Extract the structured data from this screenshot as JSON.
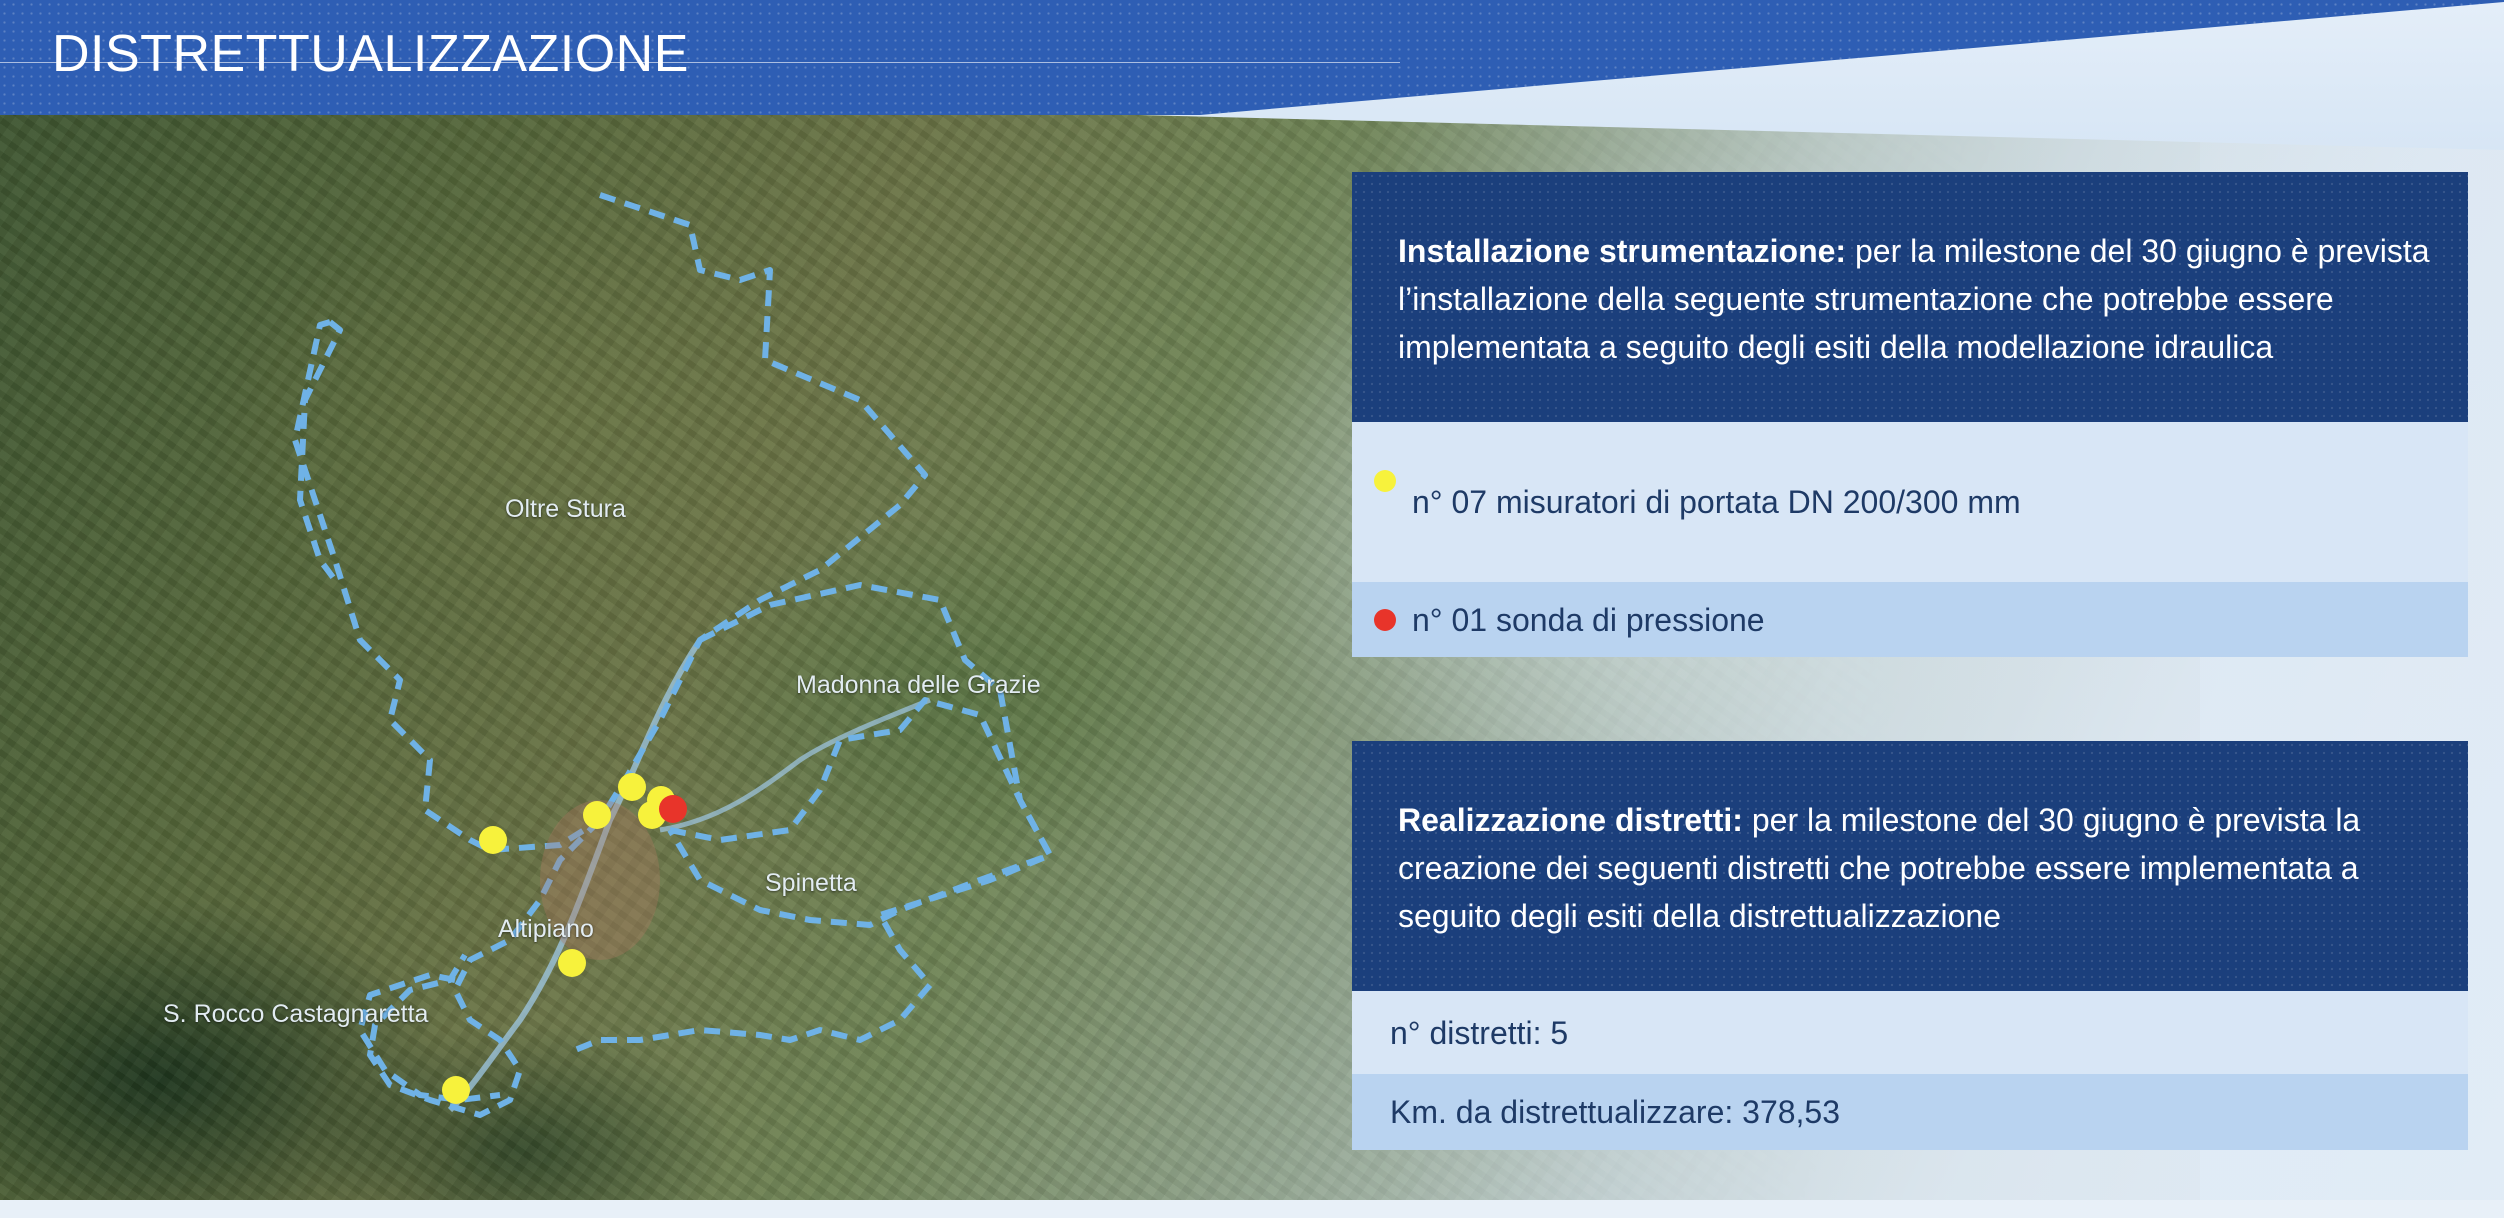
{
  "header": {
    "title": "DISTRETTUALIZZAZIONE",
    "color": "#2e5eb4"
  },
  "map": {
    "place_labels": {
      "oltre_stura": "Oltre Stura",
      "madonna_delle_grazie": "Madonna delle Grazie",
      "spinetta": "Spinetta",
      "altipiano": "Altipiano",
      "s_rocco": "S. Rocco Castagnaretta"
    },
    "district_boundary_color": "#6fb2e6",
    "marker_colors": {
      "flow_meter": "#f7f23c",
      "pressure_probe": "#e8342a"
    },
    "flow_meter_count_shown": 7,
    "pressure_probe_count_shown": 1
  },
  "instrumentation": {
    "heading": "Installazione strumentazione:",
    "text": " per la milestone del 30 giugno è prevista l’installazione della seguente strumentazione che potrebbe essere implementata a seguito degli esiti della modellazione idraulica",
    "items": [
      {
        "label": "n° 07 misuratori di portata DN 200/300 mm",
        "icon": "yellow-dot-icon"
      },
      {
        "label": "n° 01 sonda di pressione",
        "icon": "red-dot-icon"
      }
    ]
  },
  "districts": {
    "heading": "Realizzazione distretti:",
    "text": " per la milestone del 30 giugno è prevista la creazione dei seguenti distretti che potrebbe essere implementata a seguito degli esiti della distrettualizzazione",
    "items": [
      {
        "label": "n° distretti: 5"
      },
      {
        "label": "Km. da distrettualizzare: 378,53"
      }
    ]
  },
  "colors": {
    "panel_dark": "#1b3f7c",
    "row_light": "#d8e6f6",
    "row_mid": "#b9d3f0",
    "text_dark": "#1e3a66"
  }
}
